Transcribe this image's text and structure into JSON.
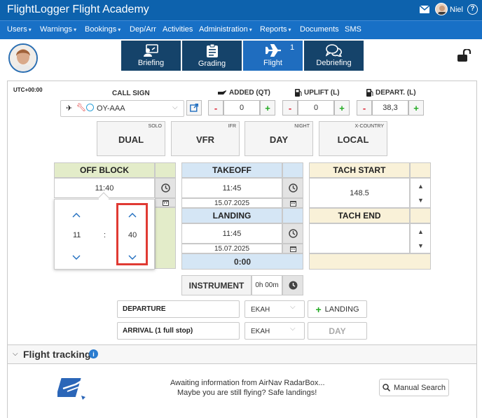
{
  "app": {
    "title": "FlightLogger Flight Academy",
    "user_name": "Niel"
  },
  "menu": [
    {
      "label": "Users",
      "caret": true
    },
    {
      "label": "Warnings",
      "caret": true
    },
    {
      "label": "Bookings",
      "caret": true
    },
    {
      "label": "Dep/Arr",
      "caret": false
    },
    {
      "label": "Activities",
      "caret": false
    },
    {
      "label": "Administration",
      "caret": true
    },
    {
      "label": "Reports",
      "caret": true
    },
    {
      "label": "Documents",
      "caret": false
    },
    {
      "label": "SMS",
      "caret": false
    }
  ],
  "tabs": [
    {
      "label": "Briefing",
      "icon": "briefing-icon"
    },
    {
      "label": "Grading",
      "icon": "clipboard-icon"
    },
    {
      "label": "Flight",
      "icon": "plane-icon",
      "badge": "1",
      "active": true
    },
    {
      "label": "Debriefing",
      "icon": "chat-icon"
    }
  ],
  "timezone": "UTC+00:00",
  "callsign": {
    "label": "CALL SIGN",
    "value": "OY-AAA"
  },
  "added": {
    "label": "ADDED (QT)",
    "value": "0"
  },
  "uplift": {
    "label": "UPLIFT (L)",
    "value": "0"
  },
  "depart": {
    "label": "DEPART. (L)",
    "value": "38,3"
  },
  "toggles": [
    {
      "alt": "SOLO",
      "main": "DUAL"
    },
    {
      "alt": "IFR",
      "main": "VFR"
    },
    {
      "alt": "NIGHT",
      "main": "DAY"
    },
    {
      "alt": "X-COUNTRY",
      "main": "LOCAL"
    }
  ],
  "off_block": {
    "label": "OFF BLOCK",
    "time": "11:40"
  },
  "time_picker": {
    "hours": "11",
    "separator": ":",
    "minutes": "40"
  },
  "takeoff": {
    "label": "TAKEOFF",
    "time": "11:45",
    "date": "15.07.2025"
  },
  "landing": {
    "label": "LANDING",
    "time": "11:45",
    "date": "15.07.2025",
    "duration": "0:00"
  },
  "tach_start": {
    "label": "TACH START",
    "value": "148.5"
  },
  "tach_end": {
    "label": "TACH END",
    "value": ""
  },
  "instrument": {
    "label": "INSTRUMENT",
    "value": "0h 00m"
  },
  "departure": {
    "label": "DEPARTURE",
    "airport": "EKAH",
    "action": "LANDING"
  },
  "arrival": {
    "label": "ARRIVAL (1 full stop)",
    "airport": "EKAH",
    "day": "DAY"
  },
  "tracking": {
    "title": "Flight tracking",
    "message_line1": "Awaiting information from AirNav RadarBox...",
    "message_line2": "Maybe you are still flying? Safe landings!",
    "search_button": "Manual Search"
  }
}
